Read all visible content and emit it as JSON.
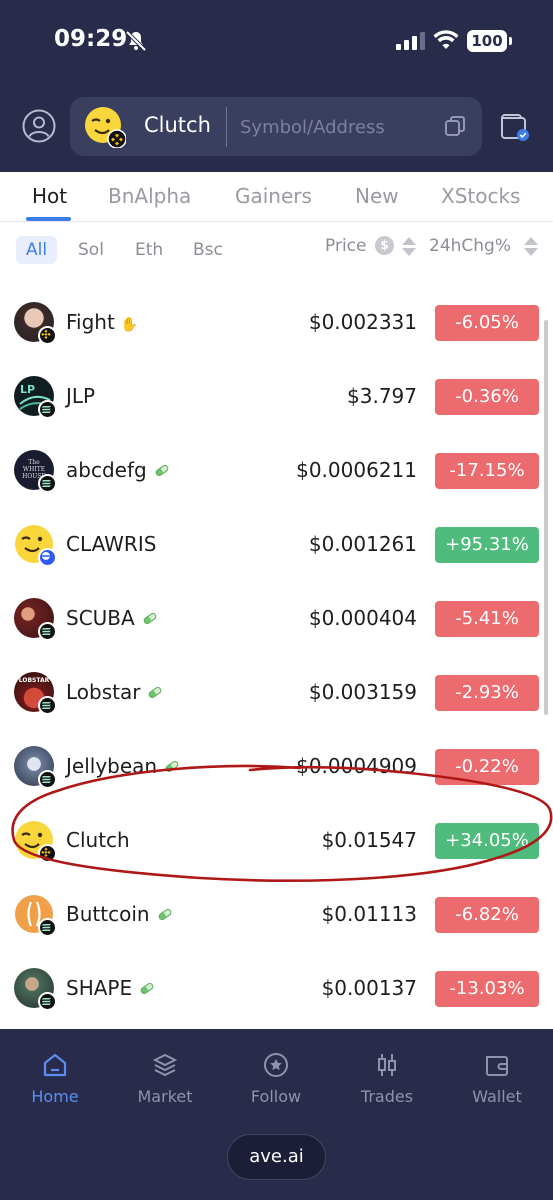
{
  "status_bar": {
    "time": "09:29",
    "battery": "100"
  },
  "search": {
    "token_name": "Clutch",
    "placeholder": "Symbol/Address"
  },
  "tabs": [
    {
      "label": "Hot",
      "active": true
    },
    {
      "label": "BnAlpha",
      "active": false
    },
    {
      "label": "Gainers",
      "active": false
    },
    {
      "label": "New",
      "active": false
    },
    {
      "label": "XStocks",
      "active": false
    }
  ],
  "chains": [
    {
      "label": "All",
      "active": true
    },
    {
      "label": "Sol",
      "active": false
    },
    {
      "label": "Eth",
      "active": false
    },
    {
      "label": "Bsc",
      "active": false
    }
  ],
  "columns": {
    "price": "Price",
    "price_unit_icon": "$",
    "change": "24hChg%"
  },
  "tokens": [
    {
      "name": "Fight",
      "price": "$0.002331",
      "change": "-6.05%",
      "direction": "down",
      "chain": "bsc"
    },
    {
      "name": "JLP",
      "price": "$3.797",
      "change": "-0.36%",
      "direction": "down",
      "chain": "sol"
    },
    {
      "name": "abcdefg",
      "price": "$0.0006211",
      "change": "-17.15%",
      "direction": "down",
      "chain": "sol"
    },
    {
      "name": "CLAWRIS",
      "price": "$0.001261",
      "change": "+95.31%",
      "direction": "up",
      "chain": "base"
    },
    {
      "name": "SCUBA",
      "price": "$0.000404",
      "change": "-5.41%",
      "direction": "down",
      "chain": "sol"
    },
    {
      "name": "Lobstar",
      "price": "$0.003159",
      "change": "-2.93%",
      "direction": "down",
      "chain": "sol"
    },
    {
      "name": "Jellybean",
      "price": "$0.0004909",
      "change": "-0.22%",
      "direction": "down",
      "chain": "sol"
    },
    {
      "name": "Clutch",
      "price": "$0.01547",
      "change": "+34.05%",
      "direction": "up",
      "chain": "bsc"
    },
    {
      "name": "Buttcoin",
      "price": "$0.01113",
      "change": "-6.82%",
      "direction": "down",
      "chain": "sol"
    },
    {
      "name": "SHAPE",
      "price": "$0.00137",
      "change": "-13.03%",
      "direction": "down",
      "chain": "sol"
    }
  ],
  "avatar_text": {
    "jlp": "LP",
    "abcdefg": "The WHITE HOUSE",
    "lobstar": "LOBSTAR"
  },
  "nav": [
    {
      "label": "Home",
      "icon": "home-icon",
      "active": true
    },
    {
      "label": "Market",
      "icon": "market-layers-icon",
      "active": false
    },
    {
      "label": "Follow",
      "icon": "follow-star-icon",
      "active": false
    },
    {
      "label": "Trades",
      "icon": "trades-candles-icon",
      "active": false
    },
    {
      "label": "Wallet",
      "icon": "wallet-icon",
      "active": false
    }
  ],
  "domain": "ave.ai",
  "colors": {
    "up": "#4fbb7c",
    "down": "#eb6b6f",
    "accent": "#3d7de8",
    "dark_bg": "#282c4a",
    "annotation": "#b01818"
  }
}
